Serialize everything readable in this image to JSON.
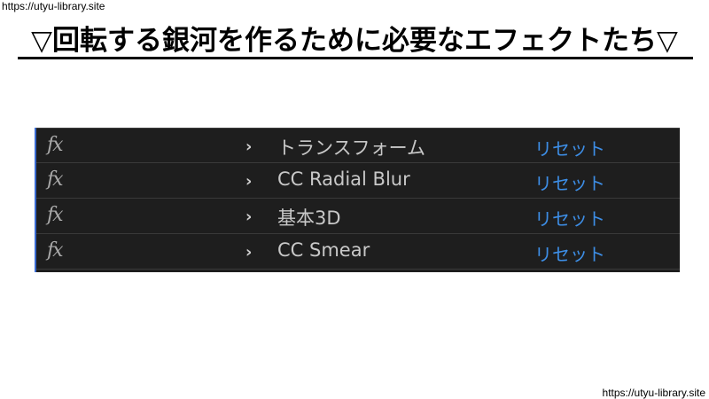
{
  "watermark": {
    "top": "https://utyu-library.site",
    "bottom": "https://utyu-library.site"
  },
  "title": "▽回転する銀河を作るために必要なエフェクトたち▽",
  "panel": {
    "accent_color": "#3a6bd0",
    "background": "#1e1e1e",
    "effects": [
      {
        "icon": "fx-icon",
        "fx_label": "fx",
        "chevron": "›",
        "name": "トランスフォーム",
        "reset_label": "リセット"
      },
      {
        "icon": "fx-icon",
        "fx_label": "fx",
        "chevron": "›",
        "name": "CC Radial Blur",
        "reset_label": "リセット"
      },
      {
        "icon": "fx-icon",
        "fx_label": "fx",
        "chevron": "›",
        "name": "基本3D",
        "reset_label": "リセット"
      },
      {
        "icon": "fx-icon",
        "fx_label": "fx",
        "chevron": "›",
        "name": "CC Smear",
        "reset_label": "リセット"
      }
    ],
    "reset_color": "#3d8ee6"
  }
}
